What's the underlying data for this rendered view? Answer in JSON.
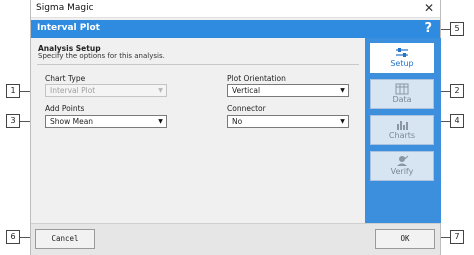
{
  "window": {
    "title": "Sigma Magic"
  },
  "header": {
    "title": "Interval Plot",
    "help": "?"
  },
  "setup": {
    "title": "Analysis Setup",
    "description": "Specify the options for this analysis."
  },
  "fields": {
    "chart_type": {
      "label": "Chart Type",
      "value": "Interval Plot"
    },
    "plot_orientation": {
      "label": "Plot Orientation",
      "value": "Vertical"
    },
    "add_points": {
      "label": "Add Points",
      "value": "Show Mean"
    },
    "connector": {
      "label": "Connector",
      "value": "No"
    }
  },
  "nav": [
    {
      "label": "Setup",
      "icon": "sliders-icon",
      "active": true
    },
    {
      "label": "Data",
      "icon": "table-icon",
      "active": false
    },
    {
      "label": "Charts",
      "icon": "bar-chart-icon",
      "active": false
    },
    {
      "label": "Verify",
      "icon": "check-person-icon",
      "active": false
    }
  ],
  "buttons": {
    "cancel": "Cancel",
    "ok": "OK"
  },
  "callouts": [
    "1",
    "2",
    "3",
    "4",
    "5",
    "6",
    "7"
  ],
  "colors": {
    "header": "#2e8be0",
    "nav": "#3c8fdc",
    "accent": "#1f73c8"
  }
}
